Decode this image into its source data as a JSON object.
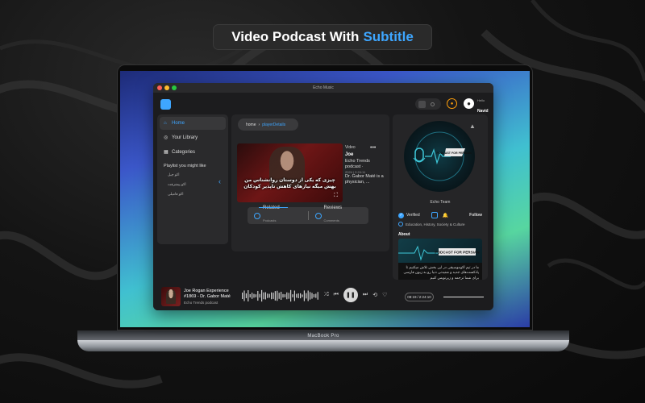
{
  "headline": {
    "prefix": "Video Podcast With",
    "accent": "Subtitle"
  },
  "colors": {
    "accent": "#3ea6ff",
    "bell": "#ff9f0a",
    "window_bg": "#1c1c1e",
    "panel_bg": "#252527"
  },
  "device": {
    "model": "MacBook Pro"
  },
  "window": {
    "title": "Echo Music"
  },
  "topbar": {
    "greeting": "Hello",
    "user_name": "Navid"
  },
  "sidebar": {
    "nav": [
      {
        "label": "Home",
        "icon": "home-icon",
        "active": true
      },
      {
        "label": "Your Library",
        "icon": "library-icon",
        "active": false
      },
      {
        "label": "Categories",
        "icon": "grid-icon",
        "active": false
      }
    ],
    "playlist_heading": "Playlist you might like",
    "playlists": [
      "اکو چیل",
      "اکو پیشرفت",
      "اکو فامیلی"
    ]
  },
  "breadcrumb": {
    "root": "home",
    "current": "playerDetails"
  },
  "video": {
    "subtitle_line1": "چیزی که یکی از دوستان روانشناس من",
    "subtitle_line2": "بهش میگه نیازهای کاهش ناپذیر کودکان"
  },
  "video_info": {
    "label": "Video",
    "title": "Joe",
    "publisher": "Echo Trends podcast ·",
    "date": "2024 | 2:24:11",
    "description": "Dr. Gabor Maté is a physician, ..."
  },
  "tabs": [
    {
      "label": "Related",
      "sub": "Podcasts"
    },
    {
      "label": "Reviews",
      "sub": "Comments"
    }
  ],
  "right_panel": {
    "cover_text": "PODCAST FOR PERSIAN",
    "team": "Echo Team",
    "verified": "Verified",
    "follow": "Follow",
    "categories": "Education, History, Society & Culture",
    "about": "About",
    "about_img_text": "PODCAST FOR PERSIAN",
    "about_text": "ما در تیم اکوموسیقی در این بخش تلاش میکنیم تا پادکست‌های جدید و شنیدنی دنیا رو به زبون فارسی برای شما ترجمه و زیرنویس کنیم"
  },
  "player": {
    "track_title": "Joe Rogan Experience #1869 - Dr. Gabor Maté",
    "track_source": "Echo Trends podcast",
    "current_time": "08:19",
    "total_time": "2:24:10",
    "is_playing": true
  }
}
